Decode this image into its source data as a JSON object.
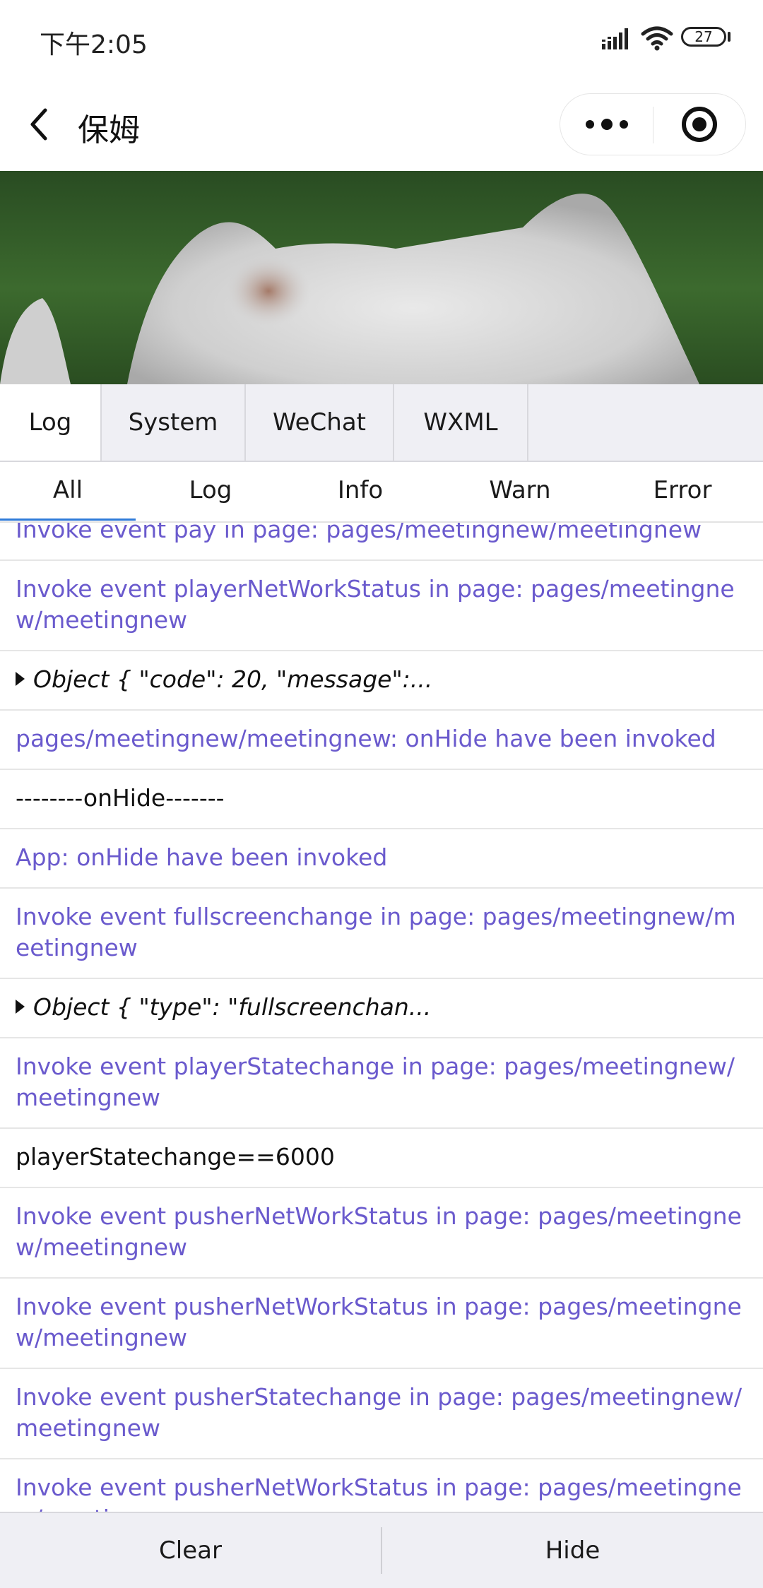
{
  "status_bar": {
    "time": "下午2:05",
    "battery": "27",
    "icons": [
      "signal-icon",
      "wifi-icon",
      "battery-icon"
    ]
  },
  "nav": {
    "title": "保姆",
    "icons": [
      "back-arrow-icon",
      "more-dots-icon",
      "record-target-icon"
    ]
  },
  "debug_tabs": [
    "Log",
    "System",
    "WeChat",
    "WXML"
  ],
  "active_tab": "Log",
  "filters": [
    "All",
    "Log",
    "Info",
    "Warn",
    "Error"
  ],
  "active_filter": "All",
  "logs": [
    {
      "level": "info",
      "text": "Invoke event pay in page: pages/meetingnew/meetingnew"
    },
    {
      "level": "info",
      "text": "Invoke event playerNetWorkStatus in page: pages/meetingnew/meetingnew"
    },
    {
      "level": "obj",
      "text": "Object { \"code\": 20, \"message\":..."
    },
    {
      "level": "info",
      "text": "pages/meetingnew/meetingnew: onHide have been invoked"
    },
    {
      "level": "plain",
      "text": "--------onHide-------"
    },
    {
      "level": "info",
      "text": "App: onHide have been invoked"
    },
    {
      "level": "info",
      "text": "Invoke event fullscreenchange in page: pages/meetingnew/meetingnew"
    },
    {
      "level": "obj",
      "text": "Object { \"type\": \"fullscreenchan..."
    },
    {
      "level": "info",
      "text": "Invoke event playerStatechange in page: pages/meetingnew/meetingnew"
    },
    {
      "level": "plain",
      "text": "playerStatechange==6000"
    },
    {
      "level": "info",
      "text": "Invoke event pusherNetWorkStatus in page: pages/meetingnew/meetingnew"
    },
    {
      "level": "info",
      "text": "Invoke event pusherNetWorkStatus in page: pages/meetingnew/meetingnew"
    },
    {
      "level": "info",
      "text": "Invoke event pusherStatechange in page: pages/meetingnew/meetingnew"
    },
    {
      "level": "info",
      "text": "Invoke event pusherNetWorkStatus in page: pages/meetingnew/meetingnew"
    }
  ],
  "bottom": {
    "clear_label": "Clear",
    "hide_label": "Hide"
  },
  "colors": {
    "info_text": "#6a5acd",
    "tab_bg": "#efeff4",
    "filter_underline": "#2f7bd9"
  }
}
